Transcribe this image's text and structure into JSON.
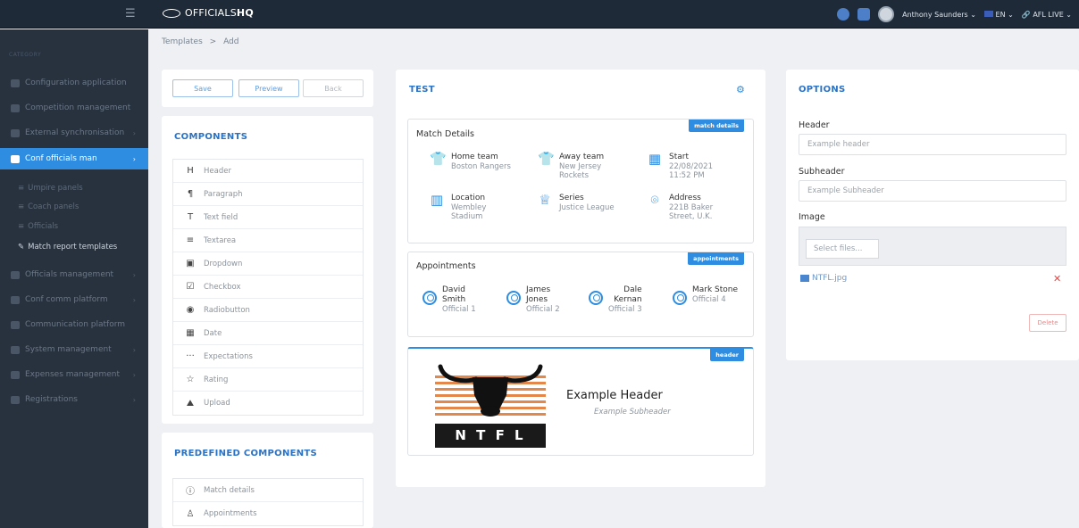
{
  "topbar": {
    "brand_light": "OFFICIALS",
    "brand_bold": "HQ",
    "user_name": "Anthony Saunders",
    "lang": "EN",
    "league": "AFL LIVE"
  },
  "sidebar": {
    "section": "CATEGORY",
    "items": [
      {
        "label": "Configuration application"
      },
      {
        "label": "Competition management"
      },
      {
        "label": "External synchronisation"
      },
      {
        "label": "Conf officials man"
      },
      {
        "label": "Officials management"
      },
      {
        "label": "Conf comm platform"
      },
      {
        "label": "Communication platform"
      },
      {
        "label": "System management"
      },
      {
        "label": "Expenses management"
      },
      {
        "label": "Registrations"
      }
    ],
    "sub_items": [
      {
        "label": "Umpire panels"
      },
      {
        "label": "Coach panels"
      },
      {
        "label": "Officials"
      },
      {
        "label": "Match report templates"
      }
    ]
  },
  "breadcrumb": {
    "root": "Templates",
    "sep": ">",
    "current": "Add"
  },
  "actions": {
    "save": "Save",
    "preview": "Preview",
    "back": "Back"
  },
  "components": {
    "title": "COMPONENTS",
    "items": [
      {
        "icon": "H",
        "label": "Header"
      },
      {
        "icon": "¶",
        "label": "Paragraph"
      },
      {
        "icon": "T",
        "label": "Text field"
      },
      {
        "icon": "≡",
        "label": "Textarea"
      },
      {
        "icon": "▣",
        "label": "Dropdown"
      },
      {
        "icon": "☑",
        "label": "Checkbox"
      },
      {
        "icon": "◉",
        "label": "Radiobutton"
      },
      {
        "icon": "▦",
        "label": "Date"
      },
      {
        "icon": "···",
        "label": "Expectations"
      },
      {
        "icon": "☆",
        "label": "Rating"
      },
      {
        "icon": "⛰",
        "label": "Upload"
      }
    ]
  },
  "predefined": {
    "title": "PREDEFINED COMPONENTS",
    "items": [
      {
        "icon": "ⓘ",
        "label": "Match details"
      },
      {
        "icon": "♙",
        "label": "Appointments"
      }
    ]
  },
  "canvas": {
    "title": "TEST",
    "match_details": {
      "badge": "match details",
      "title": "Match Details",
      "home_label": "Home team",
      "home_value": "Boston Rangers",
      "away_label": "Away team",
      "away_value": "New Jersey Rockets",
      "start_label": "Start",
      "start_value": "22/08/2021 11:52 PM",
      "location_label": "Location",
      "location_value": "Wembley Stadium",
      "series_label": "Series",
      "series_value": "Justice League",
      "address_label": "Address",
      "address_value": "221B Baker Street, U.K."
    },
    "appointments": {
      "badge": "appointments",
      "title": "Appointments",
      "people": [
        {
          "first": "David",
          "last": "Smith",
          "role": "Official 1"
        },
        {
          "first": "James",
          "last": "Jones",
          "role": "Official 2"
        },
        {
          "first": "Dale",
          "last": "Kernan",
          "role": "Official 3"
        },
        {
          "first": "Mark Stone",
          "last": "",
          "role": "Official 4"
        }
      ]
    },
    "header_block": {
      "badge": "header",
      "logo_text": "N T F L",
      "title": "Example Header",
      "subtitle": "Example Subheader"
    }
  },
  "options": {
    "title": "OPTIONS",
    "header_label": "Header",
    "header_placeholder": "Example header",
    "subheader_label": "Subheader",
    "subheader_placeholder": "Example Subheader",
    "image_label": "Image",
    "select_files": "Select files...",
    "file_name": "NTFL.jpg",
    "delete": "Delete"
  }
}
